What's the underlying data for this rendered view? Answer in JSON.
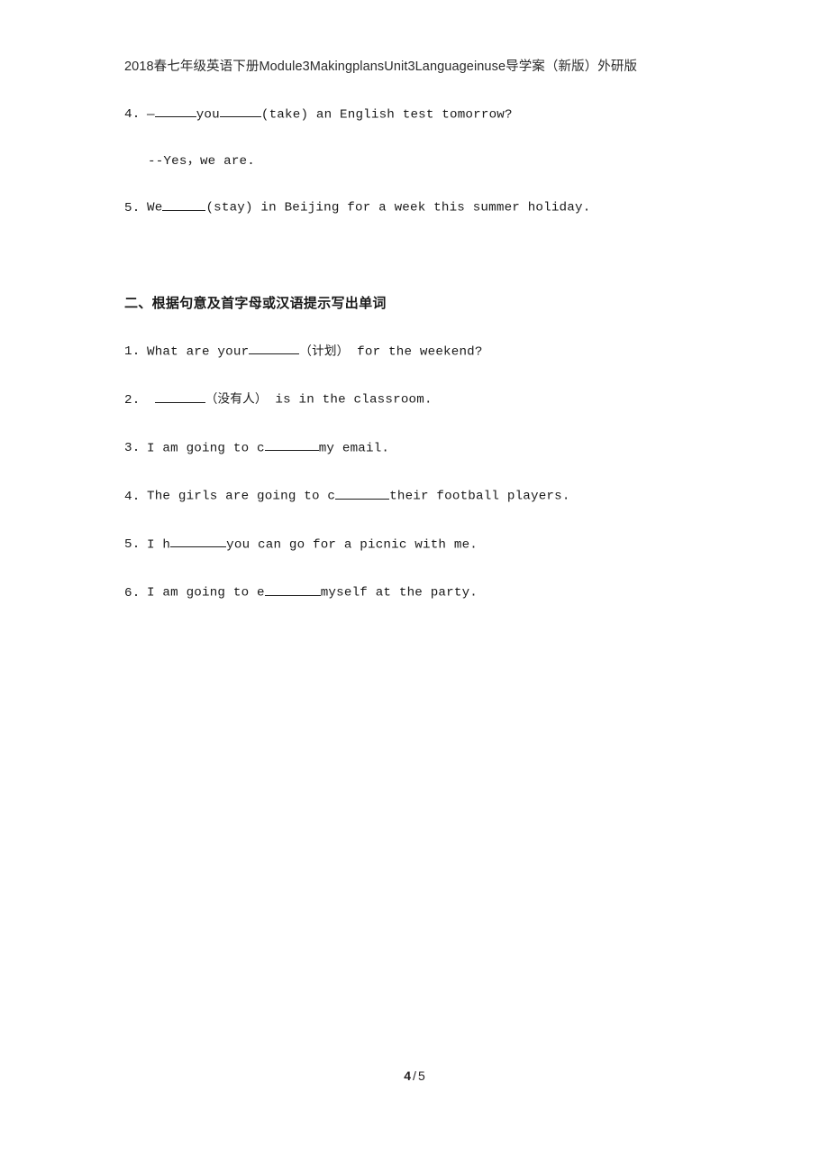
{
  "header": {
    "text": "2018春七年级英语下册Module3MakingplansUnit3Languageinuse导学案（新版）外研版"
  },
  "section_one_tail": {
    "items": [
      {
        "number": "4.",
        "parts": [
          {
            "type": "text",
            "value": "—"
          },
          {
            "type": "blank",
            "width": "w1"
          },
          {
            "type": "text",
            "value": "you"
          },
          {
            "type": "blank",
            "width": "w1"
          },
          {
            "type": "text",
            "value": "(take) an English test tomorrow?"
          }
        ]
      },
      {
        "number": "",
        "sub": true,
        "parts": [
          {
            "type": "text",
            "value": "--Yes，we are."
          }
        ]
      },
      {
        "number": "5.",
        "parts": [
          {
            "type": "text",
            "value": "We"
          },
          {
            "type": "blank",
            "width": "w2"
          },
          {
            "type": "text",
            "value": "(stay) in Beijing for a week this summer holiday."
          }
        ]
      }
    ]
  },
  "section_two": {
    "heading": "二、根据句意及首字母或汉语提示写出单词",
    "items": [
      {
        "number": "1.",
        "parts": [
          {
            "type": "text",
            "value": "What are your"
          },
          {
            "type": "blank",
            "width": "w4"
          },
          {
            "type": "cjk",
            "value": "（计划）"
          },
          {
            "type": "text",
            "value": " for the weekend?"
          }
        ]
      },
      {
        "number": "2.",
        "parts": [
          {
            "type": "text",
            "value": " "
          },
          {
            "type": "blank",
            "width": "w4"
          },
          {
            "type": "cjk",
            "value": "（没有人）"
          },
          {
            "type": "text",
            "value": " is in the classroom."
          }
        ]
      },
      {
        "number": "3.",
        "parts": [
          {
            "type": "text",
            "value": "I am going to c"
          },
          {
            "type": "blank",
            "width": "w5"
          },
          {
            "type": "text",
            "value": "my email."
          }
        ]
      },
      {
        "number": "4.",
        "parts": [
          {
            "type": "text",
            "value": "The girls are going to c"
          },
          {
            "type": "blank",
            "width": "w5"
          },
          {
            "type": "text",
            "value": "their football players."
          }
        ]
      },
      {
        "number": "5.",
        "parts": [
          {
            "type": "text",
            "value": "I h"
          },
          {
            "type": "blank",
            "width": "w6"
          },
          {
            "type": "text",
            "value": "you can go for a picnic with me."
          }
        ]
      },
      {
        "number": "6.",
        "parts": [
          {
            "type": "text",
            "value": "I am going to e"
          },
          {
            "type": "blank",
            "width": "w6"
          },
          {
            "type": "text",
            "value": "myself at the party."
          }
        ]
      }
    ]
  },
  "footer": {
    "current_page": "4",
    "separator": "/",
    "total_pages": "5"
  }
}
